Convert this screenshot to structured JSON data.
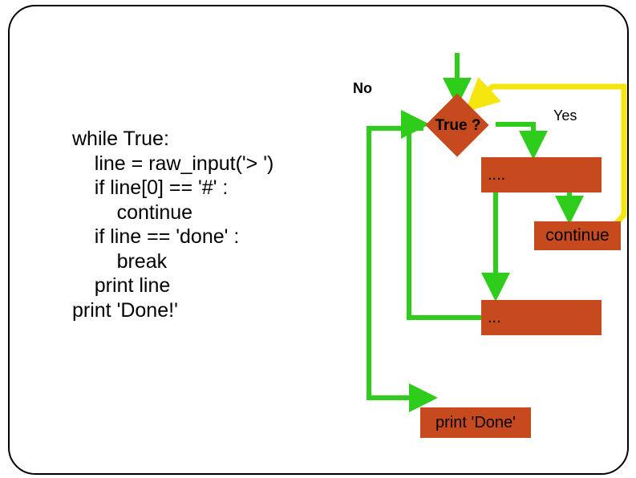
{
  "diagram": {
    "code": "while True:\n    line = raw_input('> ')\n    if line[0] == '#' :\n        continue\n    if line == 'done' :\n        break\n    print line\nprint 'Done!'",
    "labels": {
      "no": "No",
      "yes": "Yes",
      "decision": "True ?",
      "block1": "....",
      "block2": "...",
      "continue": "continue",
      "done": "print 'Done'"
    }
  },
  "chart_data": {
    "type": "flowchart",
    "nodes": [
      {
        "id": "decision",
        "kind": "decision",
        "text": "True ?"
      },
      {
        "id": "block1",
        "kind": "process",
        "text": "...."
      },
      {
        "id": "continue",
        "kind": "process",
        "text": "continue"
      },
      {
        "id": "block2",
        "kind": "process",
        "text": "..."
      },
      {
        "id": "done",
        "kind": "terminal",
        "text": "print 'Done'"
      }
    ],
    "edges": [
      {
        "from": "entry",
        "to": "decision"
      },
      {
        "from": "decision",
        "to": "block1",
        "label": "Yes"
      },
      {
        "from": "block1",
        "to": "continue"
      },
      {
        "from": "block1",
        "to": "block2"
      },
      {
        "from": "block2",
        "to": "decision",
        "kind": "loop-back"
      },
      {
        "from": "continue",
        "to": "decision",
        "kind": "loop-back"
      },
      {
        "from": "decision",
        "to": "done",
        "label": "No",
        "kind": "exit"
      }
    ]
  }
}
